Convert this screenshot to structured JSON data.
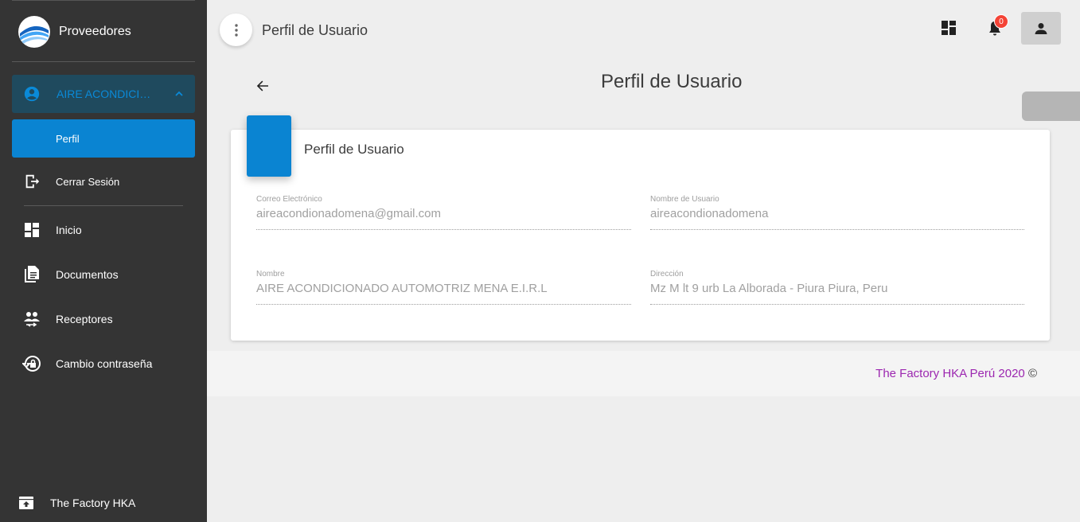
{
  "sidebar": {
    "brand": "Proveedores",
    "user_label": "AIRE ACONDICIONADO AUTOMOTRIZ MENA E.I.R.L",
    "active_item": "Perfil",
    "items": [
      {
        "label": "Cerrar Sesión",
        "icon": "logout-icon"
      },
      {
        "label": "Inicio",
        "icon": "dashboard-icon"
      },
      {
        "label": "Documentos",
        "icon": "document-icon"
      },
      {
        "label": "Receptores",
        "icon": "people-icon"
      },
      {
        "label": "Cambio contraseña",
        "icon": "lock-reset-icon"
      }
    ],
    "footer": "The Factory HKA"
  },
  "topbar": {
    "title": "Perfil de Usuario",
    "notification_count": "0"
  },
  "page": {
    "title": "Perfil de Usuario"
  },
  "card": {
    "title": "Perfil de Usuario",
    "fields": [
      {
        "label": "Correo Electrónico",
        "value": "aireacondionadomena@gmail.com"
      },
      {
        "label": "Nombre de Usuario",
        "value": "aireacondionadomena"
      },
      {
        "label": "Nombre",
        "value": "AIRE ACONDICIONADO AUTOMOTRIZ MENA E.I.R.L"
      },
      {
        "label": "Dirección",
        "value": "Mz M lt 9 urb La Alborada - Piura Piura, Peru"
      }
    ]
  },
  "footer": {
    "text": "The Factory HKA Perú 2020",
    "copyright": "©"
  },
  "colors": {
    "sidebar_bg": "#343434",
    "accent": "#0a84d2",
    "footer_link": "#9c27b0",
    "badge": "#f44336"
  }
}
